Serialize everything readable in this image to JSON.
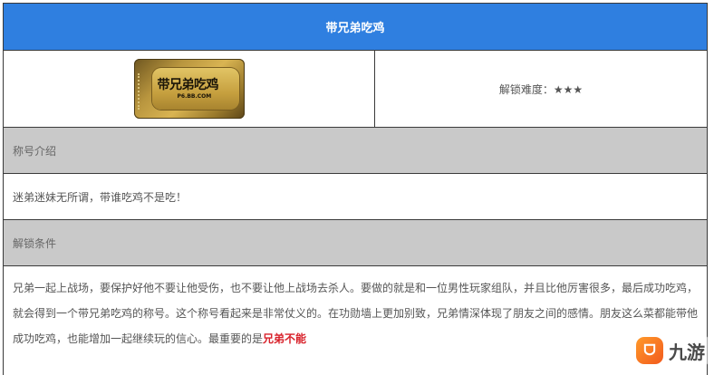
{
  "header": {
    "title": "带兄弟吃鸡"
  },
  "badge": {
    "logo_text": "带兄弟吃鸡",
    "logo_sub": "P6.BB.COM"
  },
  "difficulty": {
    "label": "解锁难度：★★★"
  },
  "intro": {
    "heading": "称号介绍",
    "text": "迷弟迷妹无所谓，带谁吃鸡不是吃！"
  },
  "unlock": {
    "heading": "解锁条件",
    "text": "兄弟一起上战场，要保护好他不要让他受伤，也不要让他上战场去杀人。要做的就是和一位男性玩家组队，并且比他厉害很多，最后成功吃鸡，就会得到一个带兄弟吃鸡的称号。这个称号看起来是非常仗义的。在功勋墙上更加别致，兄弟情深体现了朋友之间的感情。朋友这么菜都能带他成功吃鸡，也能增加一起继续玩的信心。最重要的是",
    "highlight": "兄弟不能"
  },
  "watermark": {
    "icon_text": "ᗜ",
    "text": "九游"
  }
}
